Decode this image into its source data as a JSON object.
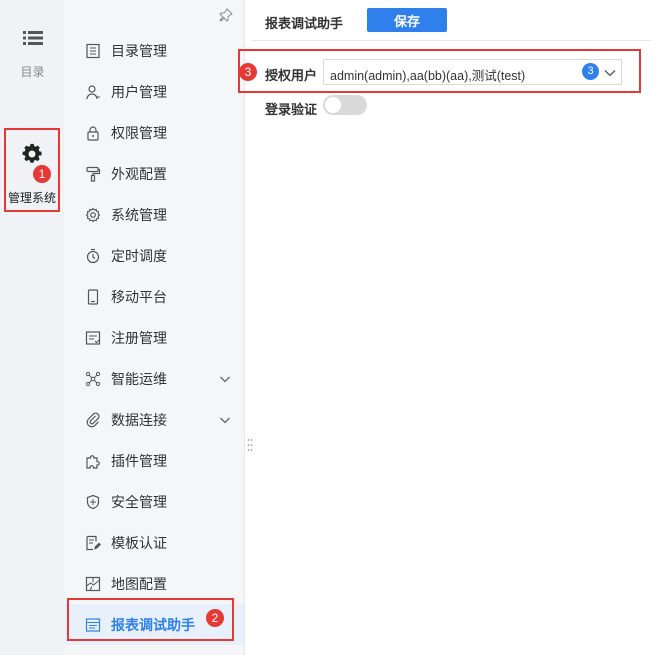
{
  "rail": {
    "directory_label": "目录",
    "admin_label": "管理系统",
    "admin_badge": "1"
  },
  "menu": {
    "items": [
      {
        "label": "目录管理",
        "icon": "catalog-icon"
      },
      {
        "label": "用户管理",
        "icon": "user-icon"
      },
      {
        "label": "权限管理",
        "icon": "lock-icon"
      },
      {
        "label": "外观配置",
        "icon": "paint-roller-icon"
      },
      {
        "label": "系统管理",
        "icon": "gear-icon"
      },
      {
        "label": "定时调度",
        "icon": "timer-icon"
      },
      {
        "label": "移动平台",
        "icon": "mobile-icon"
      },
      {
        "label": "注册管理",
        "icon": "register-icon"
      },
      {
        "label": "智能运维",
        "icon": "network-icon"
      },
      {
        "label": "数据连接",
        "icon": "link-icon"
      },
      {
        "label": "插件管理",
        "icon": "puzzle-icon"
      },
      {
        "label": "安全管理",
        "icon": "shield-icon"
      },
      {
        "label": "模板认证",
        "icon": "template-cert-icon"
      },
      {
        "label": "地图配置",
        "icon": "map-icon"
      },
      {
        "label": "报表调试助手",
        "icon": "report-icon"
      }
    ],
    "active_badge": "2"
  },
  "content": {
    "title": "报表调试助手",
    "save_label": "保存",
    "auth_badge": "3",
    "auth_label": "授权用户",
    "auth_value": "admin(admin),aa(bb)(aa),测试(test)",
    "auth_count": "3",
    "login_label": "登录验证",
    "login_enabled": false
  },
  "colors": {
    "accent": "#2f80ed",
    "highlight": "#e53935"
  }
}
